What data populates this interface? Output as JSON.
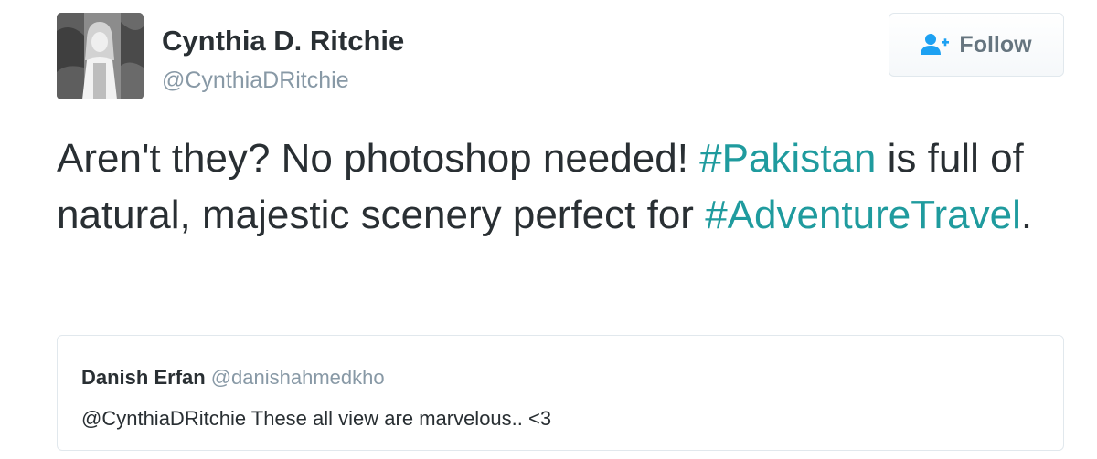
{
  "author": {
    "name": "Cynthia D. Ritchie",
    "handle": "@CynthiaDRitchie"
  },
  "follow_button": {
    "label": "Follow",
    "icon": "add-user-icon"
  },
  "tweet": {
    "text_before": "Aren't they? No photoshop needed! ",
    "hashtag1": "#Pakistan",
    "text_middle": " is full of natural, majestic scenery perfect for ",
    "hashtag2": "#AdventureTravel",
    "text_after": "."
  },
  "quoted_tweet": {
    "name": "Danish Erfan",
    "handle": "@danishahmedkho",
    "text": "@CynthiaDRitchie These all view are marvelous.. <3"
  },
  "colors": {
    "hashtag": "#1f9b9e",
    "name_text": "#292f33",
    "handle_text": "#8899a6",
    "border": "#e1e8ed"
  }
}
